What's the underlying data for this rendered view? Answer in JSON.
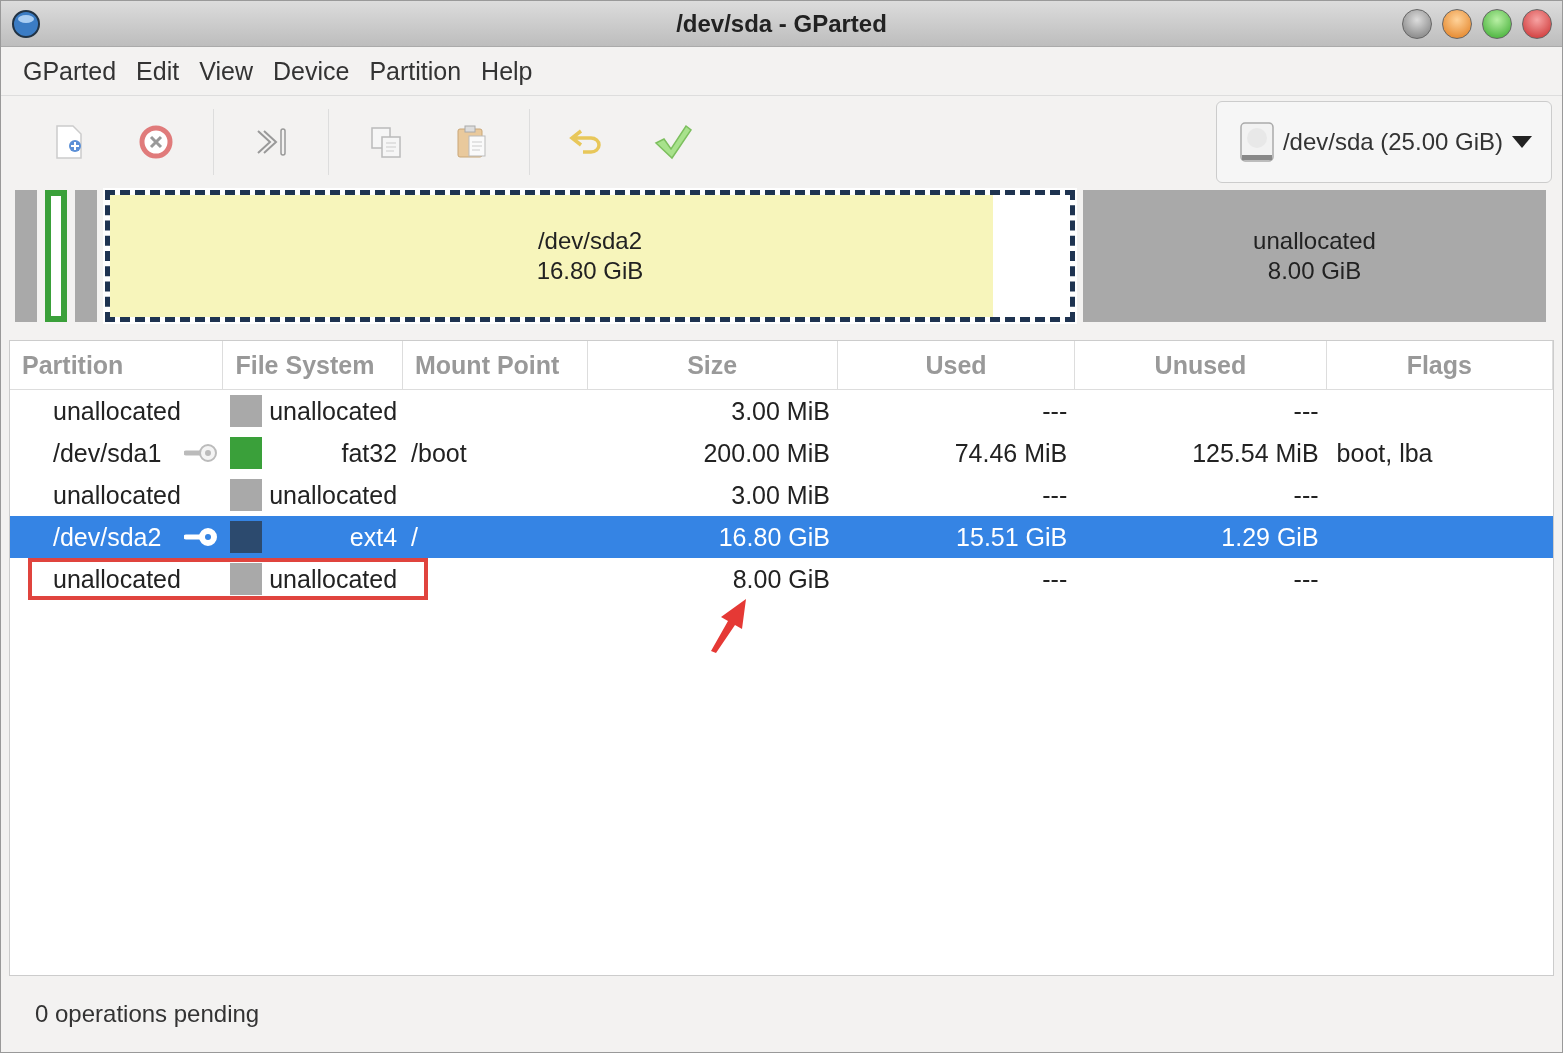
{
  "window": {
    "title": "/dev/sda - GParted"
  },
  "menu": [
    "GParted",
    "Edit",
    "View",
    "Device",
    "Partition",
    "Help"
  ],
  "toolbar": [
    {
      "kind": "new"
    },
    {
      "kind": "delete"
    },
    {
      "kind": "resize"
    },
    {
      "kind": "copy"
    },
    {
      "kind": "paste"
    },
    {
      "kind": "undo"
    },
    {
      "kind": "apply"
    }
  ],
  "device_selector": {
    "label": "/dev/sda (25.00 GiB)"
  },
  "disk_map": [
    {
      "kind": "sliver",
      "color": "#a9a9a9",
      "selected": false
    },
    {
      "kind": "sliver-outline",
      "color": "#3aa03a",
      "selected": false
    },
    {
      "kind": "sliver",
      "color": "#a9a9a9",
      "selected": false
    },
    {
      "kind": "partition",
      "name": "/dev/sda2",
      "size": "16.80 GiB",
      "level": 0.92,
      "selected": true
    },
    {
      "kind": "unallocated",
      "name": "unallocated",
      "size": "8.00 GiB",
      "selected": false
    }
  ],
  "table": {
    "columns": [
      "Partition",
      "File System",
      "Mount Point",
      "Size",
      "Used",
      "Unused",
      "Flags"
    ],
    "rows": [
      {
        "partition": "unallocated",
        "mounted": false,
        "color": "#a9a9a9",
        "file_system": "unallocated",
        "mount_point": "",
        "size": "3.00 MiB",
        "used": "---",
        "unused": "---",
        "flags": "",
        "selected": false,
        "highlighted": false
      },
      {
        "partition": "/dev/sda1",
        "mounted": true,
        "color": "#3aa03a",
        "file_system": "fat32",
        "mount_point": "/boot",
        "size": "200.00 MiB",
        "used": "74.46 MiB",
        "unused": "125.54 MiB",
        "flags": "boot, lba",
        "selected": false,
        "highlighted": false
      },
      {
        "partition": "unallocated",
        "mounted": false,
        "color": "#a9a9a9",
        "file_system": "unallocated",
        "mount_point": "",
        "size": "3.00 MiB",
        "used": "---",
        "unused": "---",
        "flags": "",
        "selected": false,
        "highlighted": false
      },
      {
        "partition": "/dev/sda2",
        "mounted": true,
        "color": "#2c4a6e",
        "file_system": "ext4",
        "mount_point": "/",
        "size": "16.80 GiB",
        "used": "15.51 GiB",
        "unused": "1.29 GiB",
        "flags": "",
        "selected": true,
        "highlighted": false
      },
      {
        "partition": "unallocated",
        "mounted": false,
        "color": "#a9a9a9",
        "file_system": "unallocated",
        "mount_point": "",
        "size": "8.00 GiB",
        "used": "---",
        "unused": "---",
        "flags": "",
        "selected": false,
        "highlighted": true
      }
    ]
  },
  "status_bar": {
    "text": "0 operations pending"
  }
}
